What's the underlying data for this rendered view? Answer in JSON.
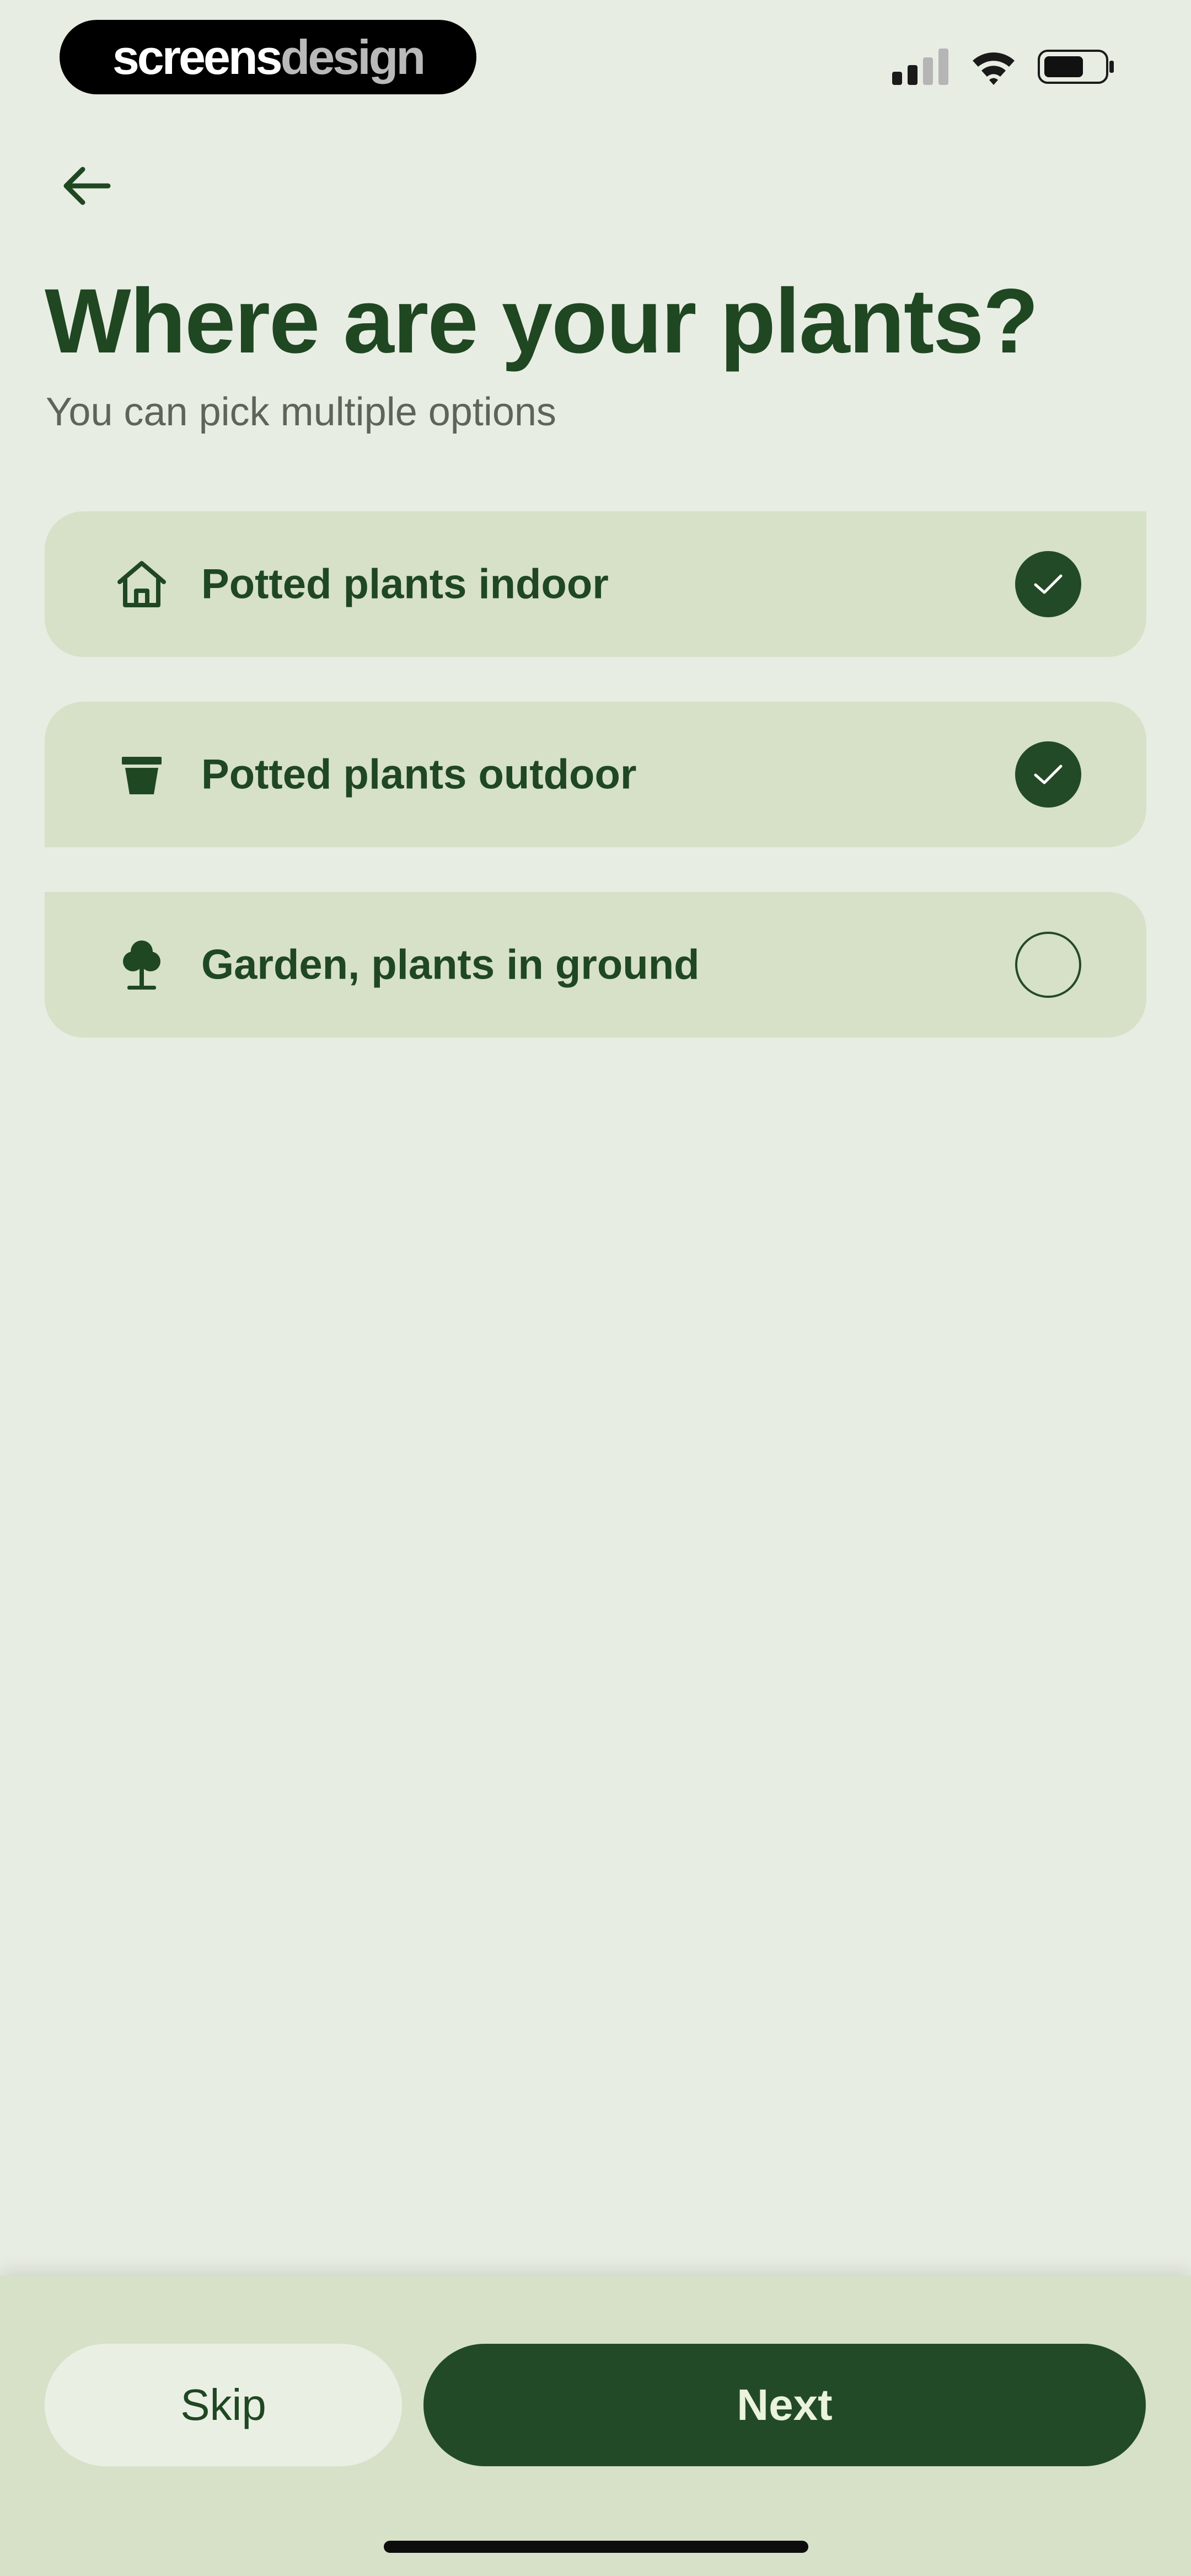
{
  "status_bar": {
    "brand_part1": "screens",
    "brand_part2": "design"
  },
  "header": {
    "title": "Where are your plants?",
    "subtitle": "You can pick multiple options"
  },
  "options": [
    {
      "label": "Potted plants indoor",
      "icon": "house-icon",
      "checked": true
    },
    {
      "label": "Potted plants outdoor",
      "icon": "flower-pot-icon",
      "checked": true
    },
    {
      "label": "Garden, plants in ground",
      "icon": "tree-icon",
      "checked": false
    }
  ],
  "footer": {
    "skip_label": "Skip",
    "next_label": "Next"
  },
  "colors": {
    "background": "#e8ede3",
    "card": "#d6e1c8",
    "accent_dark_green": "#234a26",
    "text_green": "#1f4722",
    "subtitle_gray": "#5c645c"
  }
}
